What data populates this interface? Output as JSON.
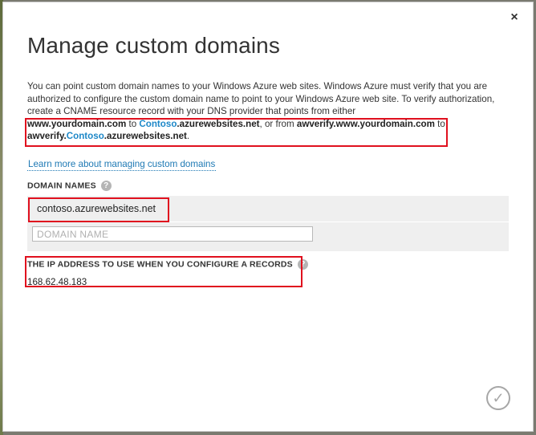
{
  "dialog": {
    "title": "Manage custom domains",
    "close_label": "×",
    "description": {
      "intro": "You can point custom domain names to your Windows Azure web sites. Windows Azure must verify that you are authorized to configure the custom domain name to point to your Windows Azure web site. To verify authorization, create a CNAME resource record with your DNS provider that points from either",
      "domain1": "www.yourdomain.com",
      "to1": " to ",
      "host1_prefix": "Contoso",
      "host1_suffix": ".azurewebsites.net",
      "or_from": ", or from ",
      "verify_domain": "awverify.www.yourdomain.com",
      "to2": " to",
      "verify_prefix": "awverify.",
      "host2_prefix": "Contoso",
      "host2_suffix": ".azurewebsites.net",
      "end": "."
    },
    "learn_more_link": "Learn more about managing custom domains",
    "domain_names": {
      "label": "DOMAIN NAMES",
      "help_icon": "?",
      "existing": "contoso.azurewebsites.net",
      "input_placeholder": "DOMAIN NAME"
    },
    "ip_section": {
      "label": "THE IP ADDRESS TO USE WHEN YOU CONFIGURE A RECORDS",
      "help_icon": "?",
      "value": "168.62.48.183"
    },
    "ok_label": "✓",
    "accent_color": "#1e88c8",
    "highlight_color": "#e0101e"
  }
}
